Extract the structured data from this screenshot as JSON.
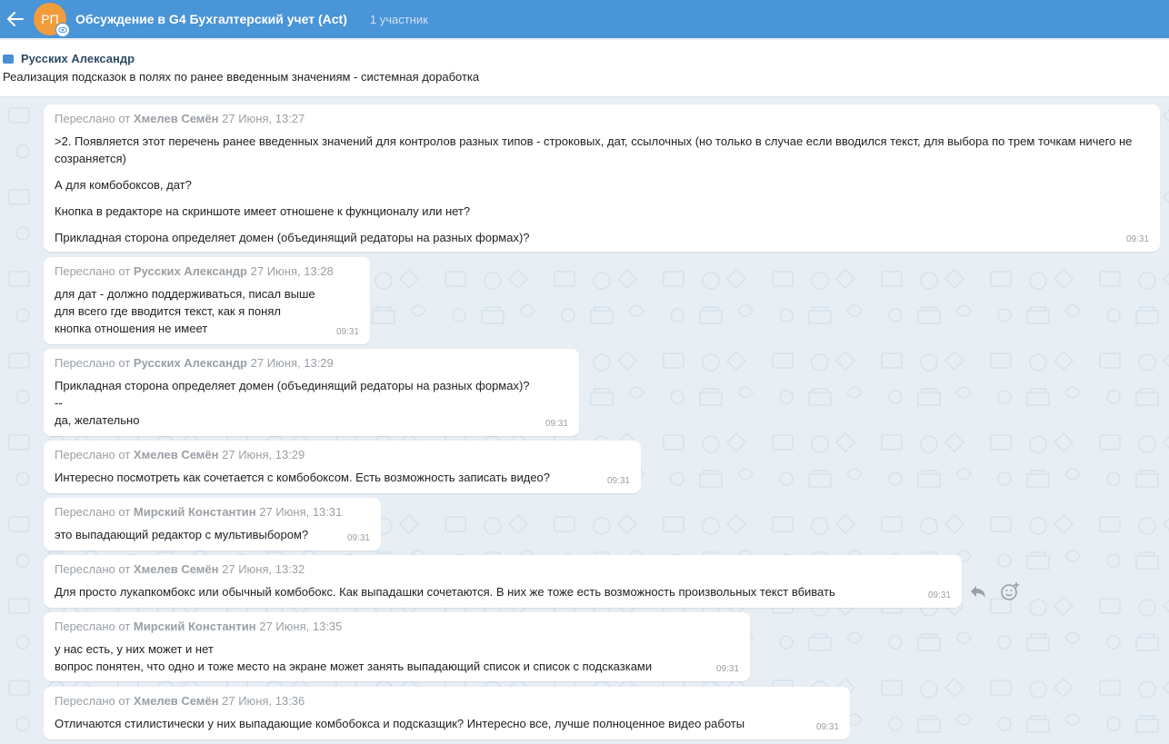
{
  "header": {
    "avatar_initials": "РП",
    "title": "Обсуждение в G4 Бухгалтерский учет (Act)",
    "participants": "1 участник",
    "accent": "#4a94d8"
  },
  "pinned": {
    "author": "Русских Александр",
    "text": "Реализация подсказок в полях по ранее введенным значениям - системная доработка"
  },
  "labels": {
    "forwarded_from": "Переслано от"
  },
  "messages": [
    {
      "author": "Хмелев Семён",
      "date": "27 Июня, 13:27",
      "paragraphs": [
        ">2. Появляется этот перечень ранее введенных значений для контролов разных типов - строковых, дат, ссылочных (но только в случае если вводился текст, для выбора по трем точкам ничего не созраняется)",
        "А для комбобоксов, дат?",
        "Кнопка в редакторе на скриншоте имеет отношене к фукнционалу или нет?",
        "Прикладная сторона определяет домен (объединящий редаторы на разных формах)?"
      ],
      "time": "09:31"
    },
    {
      "author": "Русских Александр",
      "date": "27 Июня, 13:28",
      "paragraphs": [
        "для дат - должно поддерживаться, писал выше\nдля всего где вводится текст, как я понял\nкнопка отношения не имеет"
      ],
      "time": "09:31"
    },
    {
      "author": "Русских Александр",
      "date": "27 Июня, 13:29",
      "paragraphs": [
        "Прикладная сторона определяет домен (объединящий редаторы на разных формах)?\n--\nда, желательно"
      ],
      "time": "09:31"
    },
    {
      "author": "Хмелев Семён",
      "date": "27 Июня, 13:29",
      "paragraphs": [
        "Интересно посмотреть как сочетается с комбобоксом. Есть возможность записать видео?"
      ],
      "time": "09:31"
    },
    {
      "author": "Мирский Константин",
      "date": "27 Июня, 13:31",
      "paragraphs": [
        "это выпадающий редактор с мультивыбором?"
      ],
      "time": "09:31"
    },
    {
      "author": "Хмелев Семён",
      "date": "27 Июня, 13:32",
      "paragraphs": [
        "Для просто лукапкомбокс или обычный комбобокс. Как выпадашки сочетаются. В них же тоже есть возможность произвольных текст вбивать"
      ],
      "time": "09:31"
    },
    {
      "author": "Мирский Константин",
      "date": "27 Июня, 13:35",
      "paragraphs": [
        "у нас есть, у них может и нет\nвопрос понятен, что одно и тоже место на экране может занять выпадающий список и список с подсказками"
      ],
      "time": "09:31"
    },
    {
      "author": "Хмелев Семён",
      "date": "27 Июня, 13:36",
      "paragraphs": [
        "Отличаются стилистически у них выпадающие комбобокса и подсказщик? Интересно все, лучше полноценное видео работы"
      ],
      "time": "09:31"
    }
  ],
  "icons": {
    "back": "back-arrow-icon",
    "avatar_badge": "eye-icon",
    "pinned": "briefcase-icon",
    "reply": "reply-icon",
    "reaction": "add-reaction-icon"
  }
}
